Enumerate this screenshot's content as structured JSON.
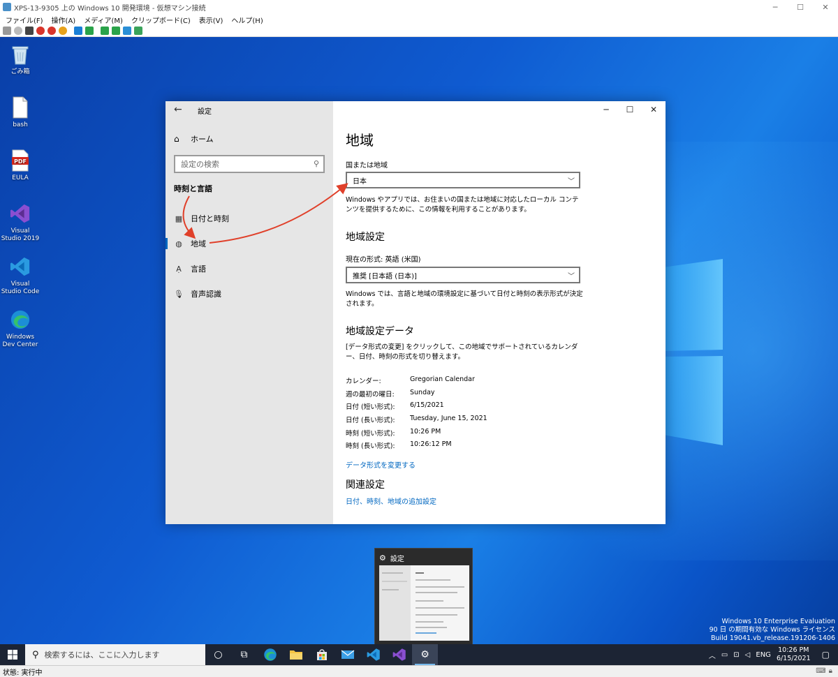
{
  "vm": {
    "title": "XPS-13-9305 上の Windows 10 開発環境 - 仮想マシン接続",
    "menu": [
      "ファイル(F)",
      "操作(A)",
      "メディア(M)",
      "クリップボード(C)",
      "表示(V)",
      "ヘルプ(H)"
    ],
    "status": "状態: 実行中"
  },
  "desktop_icons": [
    {
      "label": "ごみ箱",
      "icon": "recycle-bin-icon"
    },
    {
      "label": "bash",
      "icon": "file-icon"
    },
    {
      "label": "EULA",
      "icon": "pdf-icon",
      "badge": "PDF"
    },
    {
      "label": "Visual Studio 2019",
      "icon": "visual-studio-icon"
    },
    {
      "label": "Visual Studio Code",
      "icon": "vscode-icon"
    },
    {
      "label": "Windows Dev Center",
      "icon": "edge-icon"
    }
  ],
  "settings": {
    "app_title": "設定",
    "home": "ホーム",
    "search_placeholder": "設定の検索",
    "section": "時刻と言語",
    "nav": [
      {
        "label": "日付と時刻",
        "icon": "calendar-clock-icon"
      },
      {
        "label": "地域",
        "icon": "globe-icon",
        "active": true
      },
      {
        "label": "言語",
        "icon": "language-icon"
      },
      {
        "label": "音声認識",
        "icon": "microphone-icon"
      }
    ],
    "page_title": "地域",
    "country_label": "国または地域",
    "country_value": "日本",
    "country_desc": "Windows やアプリでは、お住まいの国または地域に対応したローカル コンテンツを提供するために、この情報を利用することがあります。",
    "format_heading": "地域設定",
    "current_format_label": "現在の形式: 英語 (米国)",
    "format_value": "推奨 [日本語 (日本)]",
    "format_desc": "Windows では、言語と地域の環境設定に基づいて日付と時刻の表示形式が決定されます。",
    "data_heading": "地域設定データ",
    "data_desc": "[データ形式の変更] をクリックして、この地域でサポートされているカレンダー、日付、時刻の形式を切り替えます。",
    "rows": [
      {
        "k": "カレンダー:",
        "v": "Gregorian Calendar"
      },
      {
        "k": "週の最初の曜日:",
        "v": "Sunday"
      },
      {
        "k": "日付 (短い形式):",
        "v": "6/15/2021"
      },
      {
        "k": "日付 (長い形式):",
        "v": "Tuesday, June 15, 2021"
      },
      {
        "k": "時刻 (短い形式):",
        "v": "10:26 PM"
      },
      {
        "k": "時刻 (長い形式):",
        "v": "10:26:12 PM"
      }
    ],
    "change_format_link": "データ形式を変更する",
    "related_heading": "関連設定",
    "related_link": "日付、時刻、地域の追加設定"
  },
  "thumbnail": {
    "title": "設定"
  },
  "watermark": {
    "line1": "Windows 10 Enterprise Evaluation",
    "line2": "90 日 の期間有効な Windows ライセンス",
    "line3": "Build 19041.vb_release.191206-1406"
  },
  "taskbar": {
    "search_placeholder": "検索するには、ここに入力します",
    "lang": "ENG",
    "time": "10:26 PM",
    "date": "6/15/2021"
  },
  "colors": {
    "accent": "#0067c0",
    "arrow": "#e0402a",
    "taskbar": "#1c2434"
  }
}
